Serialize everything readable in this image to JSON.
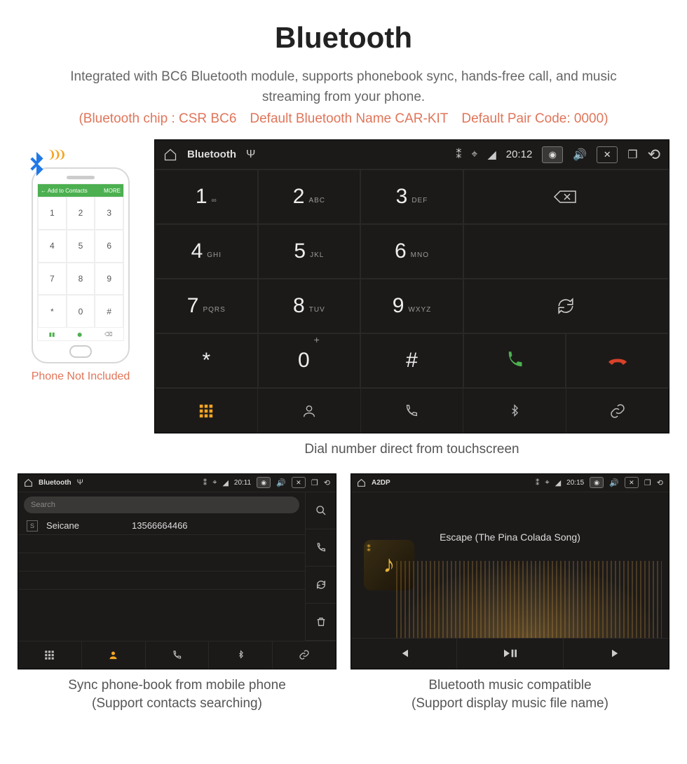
{
  "title": "Bluetooth",
  "description": "Integrated with BC6 Bluetooth module, supports phonebook sync, hands-free call, and music streaming from your phone.",
  "specs": "(Bluetooth chip : CSR BC6 Default Bluetooth Name CAR-KIT Default Pair Code: 0000)",
  "phone": {
    "topbar_left": "←  Add to Contacts",
    "topbar_right": "MORE",
    "caption": "Phone Not Included"
  },
  "dialer": {
    "status": {
      "title": "Bluetooth",
      "time": "20:12"
    },
    "keys": [
      {
        "num": "1",
        "sub": "∞"
      },
      {
        "num": "2",
        "sub": "ABC"
      },
      {
        "num": "3",
        "sub": "DEF"
      },
      {
        "num": "4",
        "sub": "GHI"
      },
      {
        "num": "5",
        "sub": "JKL"
      },
      {
        "num": "6",
        "sub": "MNO"
      },
      {
        "num": "7",
        "sub": "PQRS"
      },
      {
        "num": "8",
        "sub": "TUV"
      },
      {
        "num": "9",
        "sub": "WXYZ"
      },
      {
        "num": "*",
        "sub": ""
      },
      {
        "num": "0",
        "sub": "+",
        "sup": true
      },
      {
        "num": "#",
        "sub": ""
      }
    ],
    "caption": "Dial number direct from touchscreen"
  },
  "contacts": {
    "status": {
      "title": "Bluetooth",
      "time": "20:11"
    },
    "search": "Search",
    "row": {
      "letter": "S",
      "name": "Seicane",
      "number": "13566664466"
    },
    "caption1": "Sync phone-book from mobile phone",
    "caption2": "(Support contacts searching)"
  },
  "music": {
    "status": {
      "title": "A2DP",
      "time": "20:15"
    },
    "track": "Escape (The Pina Colada Song)",
    "caption1": "Bluetooth music compatible",
    "caption2": "(Support display music file name)"
  }
}
